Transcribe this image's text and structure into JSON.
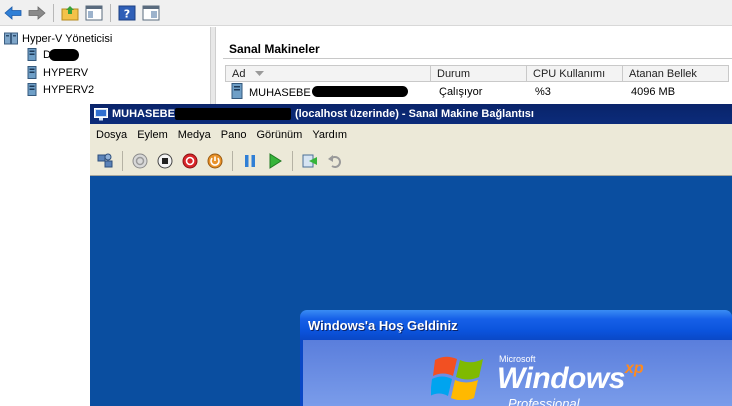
{
  "mmc": {
    "toolbar": [
      "back-arrow-icon",
      "forward-arrow-icon",
      "up-folder-icon",
      "show-hide-tree-icon",
      "help-icon",
      "properties-icon"
    ]
  },
  "tree": {
    "root": "Hyper-V Yöneticisi",
    "servers": [
      {
        "label": "D",
        "redacted": true
      },
      {
        "label": "HYPERV"
      },
      {
        "label": "HYPERV2"
      }
    ]
  },
  "vm_list": {
    "title": "Sanal Makineler",
    "columns": [
      "Ad",
      "Durum",
      "CPU Kullanımı",
      "Atanan Bellek"
    ],
    "rows": [
      {
        "name": "MUHASEBE",
        "status": "Çalışıyor",
        "cpu": "%3",
        "memory": "4096 MB"
      }
    ]
  },
  "vm_window": {
    "title_prefix": "MUHASEBE",
    "title_suffix": "(localhost üzerinde) - Sanal Makine Bağlantısı",
    "menu": [
      "Dosya",
      "Eylem",
      "Medya",
      "Pano",
      "Görünüm",
      "Yardım"
    ],
    "toolbar": [
      "ctrl-alt-del-icon",
      "start-icon",
      "turn-off-icon",
      "shut-down-icon",
      "power-icon",
      "pause-icon",
      "resume-icon",
      "snapshot-icon",
      "revert-icon"
    ]
  },
  "xp_dialog": {
    "title": "Windows'a Hoş Geldiniz",
    "microsoft": "Microsoft",
    "windows": "Windows",
    "xp": "xp",
    "edition": "Professional"
  },
  "colors": {
    "vm_screen": "#0a4ea0",
    "xp_title": "#0b53dc",
    "title_bar": "#0a246a"
  }
}
